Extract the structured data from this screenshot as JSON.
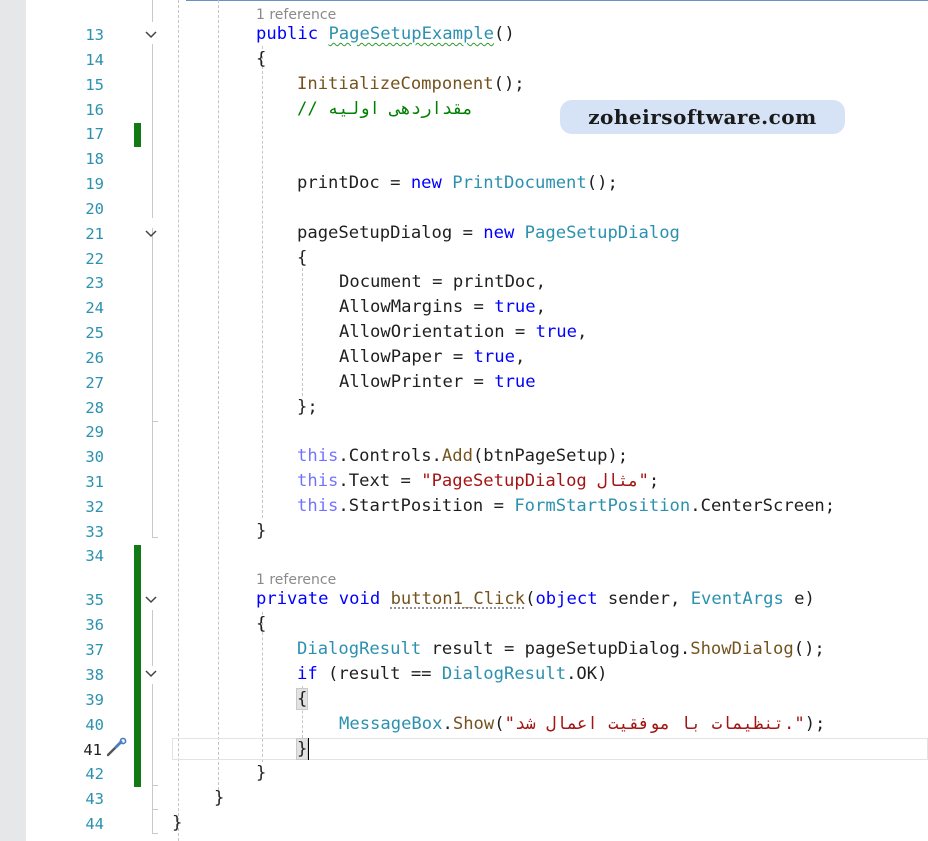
{
  "editor": {
    "line_numbers": [
      "13",
      "14",
      "15",
      "16",
      "17",
      "18",
      "19",
      "20",
      "21",
      "22",
      "23",
      "24",
      "25",
      "26",
      "27",
      "28",
      "29",
      "30",
      "31",
      "32",
      "33",
      "34",
      "35",
      "36",
      "37",
      "38",
      "39",
      "40",
      "41",
      "42",
      "43",
      "44"
    ],
    "current_line": "41",
    "codelens": [
      "1 reference",
      "1 reference"
    ],
    "code": {
      "l13": {
        "kw": "public",
        "name": "PageSetupExample",
        "rest": "()"
      },
      "l14": "{",
      "l15": {
        "method": "InitializeComponent",
        "rest": "();"
      },
      "l16": {
        "prefix": "// ",
        "text": "مقداردهی اولیه"
      },
      "l19": {
        "a": "printDoc = ",
        "kw": "new",
        "type": "PrintDocument",
        "rest": "();"
      },
      "l21": {
        "a": "pageSetupDialog = ",
        "kw": "new",
        "type": "PageSetupDialog"
      },
      "l22": "{",
      "l23": "Document = printDoc,",
      "l24": {
        "a": "AllowMargins = ",
        "kw": "true",
        "rest": ","
      },
      "l25": {
        "a": "AllowOrientation = ",
        "kw": "true",
        "rest": ","
      },
      "l26": {
        "a": "AllowPaper = ",
        "kw": "true",
        "rest": ","
      },
      "l27": {
        "a": "AllowPrinter = ",
        "kw": "true"
      },
      "l28": "};",
      "l30": {
        "this": "this",
        "a": ".Controls.",
        "method": "Add",
        "rest": "(btnPageSetup);"
      },
      "l31": {
        "this": "this",
        "a": ".Text = ",
        "string": "\"مثال PageSetupDialog\"",
        "rest": ";"
      },
      "l32": {
        "this": "this",
        "a": ".StartPosition = ",
        "type": "FormStartPosition",
        "rest": ".CenterScreen;"
      },
      "l33": "}",
      "l35": {
        "kw1": "private",
        "kw2": "void",
        "name": "button1_Click",
        "p1": "(",
        "kw3": "object",
        "p2": " sender, ",
        "type": "EventArgs",
        "p3": " e)"
      },
      "l36": "{",
      "l37": {
        "type": "DialogResult",
        "a": " result = pageSetupDialog.",
        "method": "ShowDialog",
        "rest": "();"
      },
      "l38": {
        "kw": "if",
        "a": " (result == ",
        "type": "DialogResult",
        "rest": ".OK)"
      },
      "l39": "{",
      "l40": {
        "type": "MessageBox",
        "a": ".",
        "method": "Show",
        "p": "(",
        "string": "\".تنظیمات با موفقیت اعمال شد\"",
        "rest": ");"
      },
      "l41": "}",
      "l42": "}",
      "l43": "}",
      "l44": "}"
    }
  },
  "watermark": "zoheirsoftware.com",
  "colors": {
    "keyword": "#0000ff",
    "type": "#2b91af",
    "method": "#74531f",
    "string": "#a31515",
    "comment": "#008000",
    "change_bar": "#127a12"
  }
}
